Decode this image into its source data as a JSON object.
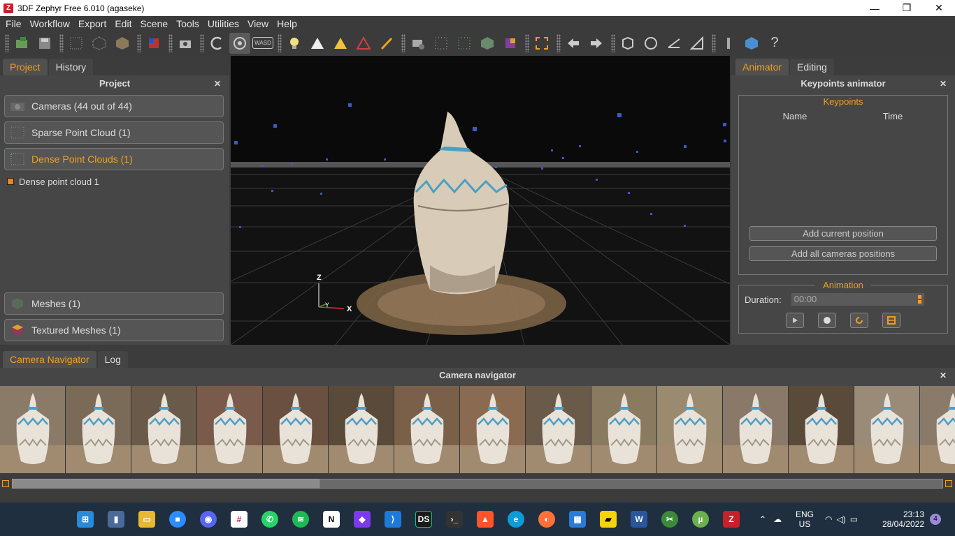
{
  "window": {
    "title": "3DF Zephyr Free 6.010 (agaseke)",
    "minimize": "—",
    "maximize": "❐",
    "close": "✕"
  },
  "menu": [
    "File",
    "Workflow",
    "Export",
    "Edit",
    "Scene",
    "Tools",
    "Utilities",
    "View",
    "Help"
  ],
  "toolbar": {
    "icons": [
      "new-project-icon",
      "save-icon",
      "sparse-icon",
      "dense-icon",
      "mesh-icon",
      "texture-icon",
      "camera-icon",
      "orbit-icon",
      "pivot-icon",
      "wasd-icon",
      "light-icon",
      "triangle-white-icon",
      "triangle-color-icon",
      "triangle-rgb-icon",
      "brush-icon",
      "camera-settings-icon",
      "points-icon",
      "grid-points-icon",
      "cube-icon",
      "colored-cube-icon",
      "frame-icon",
      "undo-icon",
      "redo-icon",
      "select-icon",
      "circle-select-icon",
      "move-icon",
      "measure-icon",
      "wrench-icon",
      "zephyr-logo-icon",
      "help-icon"
    ],
    "wasd_label": "WASD",
    "help_label": "?"
  },
  "left": {
    "tabs": [
      {
        "label": "Project",
        "active": true
      },
      {
        "label": "History",
        "active": false
      }
    ],
    "title": "Project",
    "close": "✕",
    "items": [
      {
        "label": "Cameras (44 out of 44)",
        "active": false
      },
      {
        "label": "Sparse Point Cloud (1)",
        "active": false
      },
      {
        "label": "Dense Point Clouds (1)",
        "active": true
      }
    ],
    "tree_item": "Dense point cloud 1",
    "bottom_items": [
      {
        "label": "Meshes (1)"
      },
      {
        "label": "Textured Meshes (1)"
      }
    ]
  },
  "view3d": {
    "axis_z": "Z",
    "axis_y": "Y",
    "axis_x": "X"
  },
  "right": {
    "tabs": [
      {
        "label": "Animator",
        "active": true
      },
      {
        "label": "Editing",
        "active": false
      }
    ],
    "title": "Keypoints animator",
    "close": "✕",
    "keypoints_title": "Keypoints",
    "col_name": "Name",
    "col_time": "Time",
    "add_current": "Add current position",
    "add_all": "Add all cameras positions",
    "animation_title": "Animation",
    "duration_label": "Duration:",
    "duration_value": "00:00"
  },
  "bottom": {
    "tabs": [
      {
        "label": "Camera Navigator",
        "active": true
      },
      {
        "label": "Log",
        "active": false
      }
    ],
    "title": "Camera navigator",
    "close": "✕",
    "thumbnail_count": 15
  },
  "taskbar": {
    "lang": "ENG",
    "region": "US",
    "time": "23:13",
    "date": "28/04/2022",
    "notifications": "4",
    "apps": [
      "start",
      "task-view",
      "file-explorer",
      "zoom",
      "discord",
      "slack",
      "whatsapp",
      "spotify",
      "notion",
      "obsidian",
      "vscode",
      "datagrip",
      "terminal",
      "brave",
      "edge",
      "firefox",
      "calendar",
      "sticky-notes",
      "word",
      "snip",
      "utorrent",
      "zephyr"
    ]
  }
}
